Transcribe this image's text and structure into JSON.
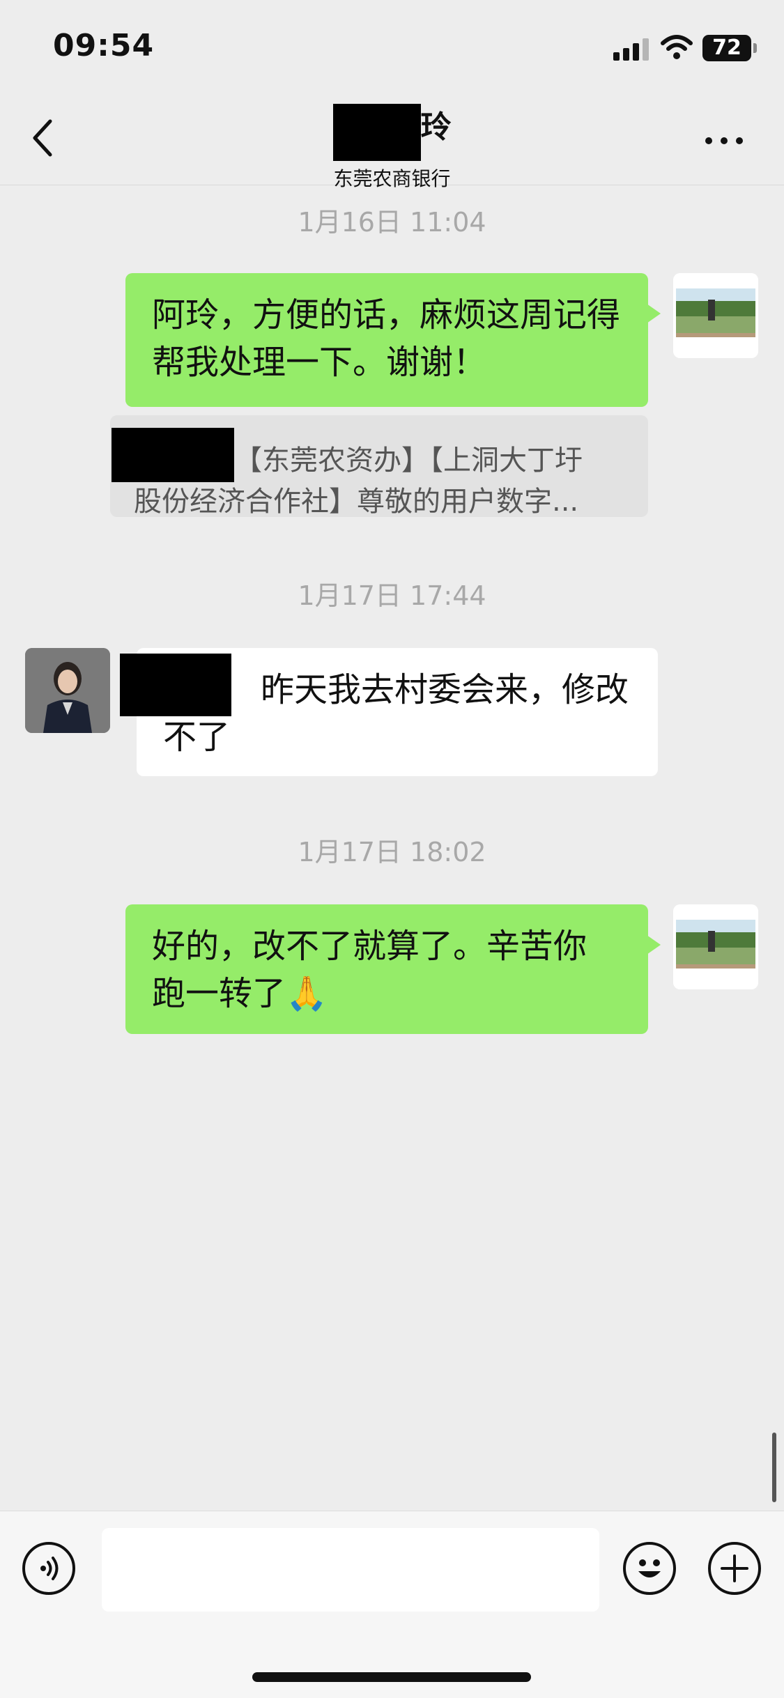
{
  "status": {
    "time": "09:54",
    "battery": "72"
  },
  "header": {
    "title_suffix": "玲",
    "subtitle": "东莞农商银行"
  },
  "messages": {
    "ts1": "1月16日 11:04",
    "m1": "阿玲，方便的话，麻烦这周记得帮我处理一下。谢谢！",
    "quote_line1": "【东莞农资办】【上洞大丁圩",
    "quote_line2": "股份经济合作社】尊敬的用户数字...",
    "ts2": "1月17日 17:44",
    "m2_line1": "昨天我去村委会来，修改",
    "m2_line2": "不了",
    "ts3": "1月17日 18:02",
    "m3_line1": "好的，改不了就算了。辛苦你",
    "m3_line2": "跑一转了",
    "m3_emoji": "🙏"
  },
  "icons": {
    "back": "chevron-left-icon",
    "more": "more-dots-icon",
    "voice": "voice-icon",
    "emoji": "emoji-icon",
    "add": "plus-icon"
  },
  "colors": {
    "outgoing_bubble": "#95ec69",
    "background": "#ededed"
  }
}
